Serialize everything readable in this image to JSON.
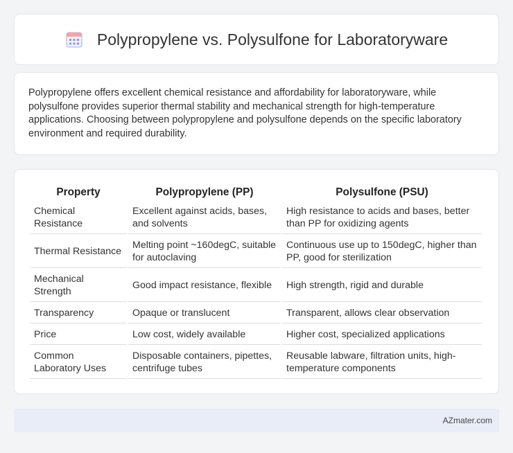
{
  "header": {
    "title": "Polypropylene vs. Polysulfone for Laboratoryware",
    "icon": "calendar-icon"
  },
  "intro": {
    "text": "Polypropylene offers excellent chemical resistance and affordability for laboratoryware, while polysulfone provides superior thermal stability and mechanical strength for high-temperature applications. Choosing between polypropylene and polysulfone depends on the specific laboratory environment and required durability."
  },
  "table": {
    "headers": [
      "Property",
      "Polypropylene (PP)",
      "Polysulfone (PSU)"
    ],
    "rows": [
      [
        "Chemical Resistance",
        "Excellent against acids, bases, and solvents",
        "High resistance to acids and bases, better than PP for oxidizing agents"
      ],
      [
        "Thermal Resistance",
        "Melting point ~160degC, suitable for autoclaving",
        "Continuous use up to 150degC, higher than PP, good for sterilization"
      ],
      [
        "Mechanical Strength",
        "Good impact resistance, flexible",
        "High strength, rigid and durable"
      ],
      [
        "Transparency",
        "Opaque or translucent",
        "Transparent, allows clear observation"
      ],
      [
        "Price",
        "Low cost, widely available",
        "Higher cost, specialized applications"
      ],
      [
        "Common Laboratory Uses",
        "Disposable containers, pipettes, centrifuge tubes",
        "Reusable labware, filtration units, high-temperature components"
      ]
    ]
  },
  "footer": {
    "brand": "AZmater.com"
  },
  "colors": {
    "icon_accent": "#7b83d6",
    "icon_header": "#f08a8a",
    "footer_bg": "#e8edf7"
  }
}
